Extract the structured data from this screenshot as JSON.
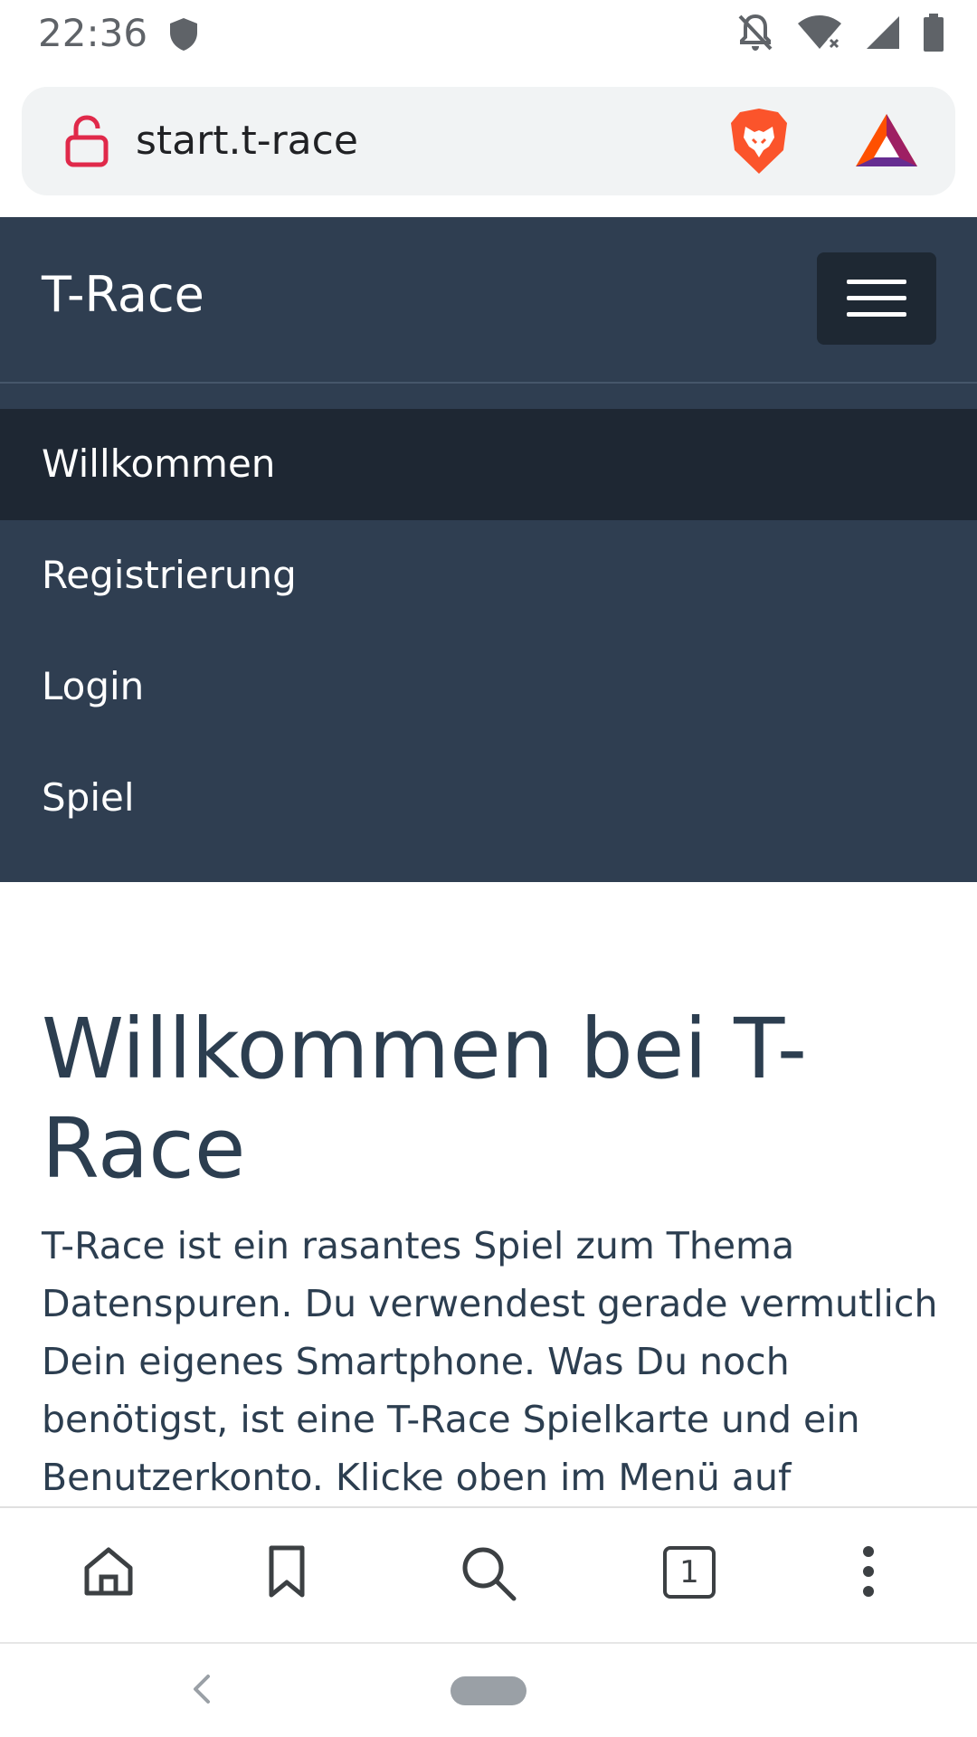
{
  "status_bar": {
    "time": "22:36"
  },
  "browser": {
    "url": "start.t-race"
  },
  "navbar": {
    "brand": "T-Race",
    "items": [
      {
        "label": "Willkommen",
        "active": true
      },
      {
        "label": "Registrierung",
        "active": false
      },
      {
        "label": "Login",
        "active": false
      },
      {
        "label": "Spiel",
        "active": false
      }
    ]
  },
  "main": {
    "heading": "Willkommen bei T-Race",
    "paragraph": "T-Race ist ein rasantes Spiel zum Thema Datenspuren. Du verwendest gerade vermutlich Dein eigenes Smartphone. Was Du noch benötigst, ist eine T-Race Spielkarte und ein Benutzerkonto. Klicke oben im Menü auf"
  },
  "toolbar": {
    "tab_count": "1"
  },
  "colors": {
    "navbar_bg": "#2f3e51",
    "nav_active_bg": "#1e2733",
    "text_primary": "#2c3e50",
    "lock_icon": "#e0294a",
    "brave_orange": "#fb542b"
  },
  "icons": {
    "status": [
      "shield-icon",
      "notifications-off-icon",
      "wifi-icon",
      "signal-icon",
      "battery-icon"
    ],
    "url_bar": [
      "unlocked-icon",
      "brave-lion-icon",
      "bat-triangle-icon"
    ],
    "toolbar": [
      "home-icon",
      "bookmark-icon",
      "search-icon",
      "tabs-icon",
      "more-vert-icon"
    ],
    "system": [
      "back-icon",
      "home-pill-icon"
    ]
  }
}
